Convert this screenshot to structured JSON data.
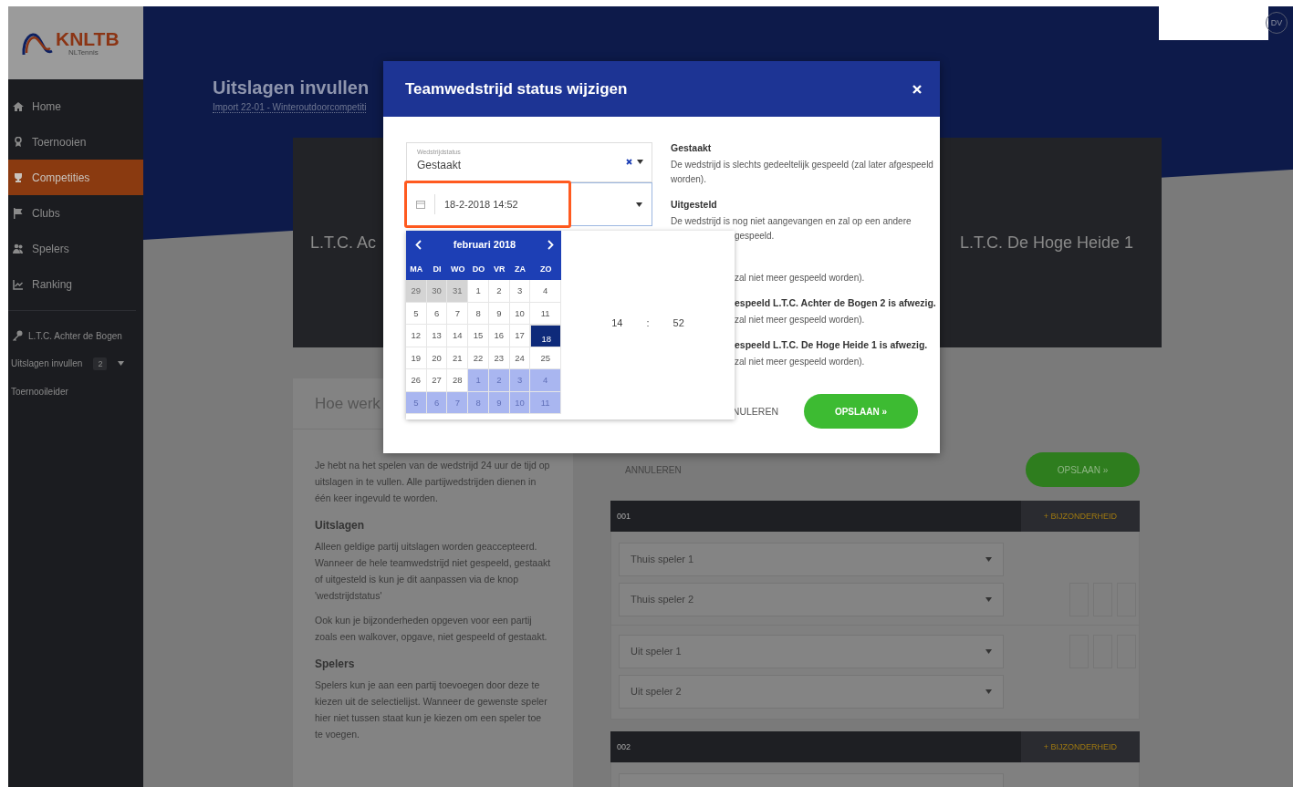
{
  "sidebar": {
    "logo": {
      "name": "KNLTB",
      "tagline": "NLTennis"
    },
    "items": [
      {
        "label": "Home",
        "selected": false
      },
      {
        "label": "Toernooien",
        "selected": false
      },
      {
        "label": "Competities",
        "selected": true
      },
      {
        "label": "Clubs",
        "selected": false
      },
      {
        "label": "Spelers",
        "selected": false
      },
      {
        "label": "Ranking",
        "selected": false
      }
    ],
    "club": "L.T.C. Achter de Bogen",
    "sub_items": [
      {
        "label": "Uitslagen invullen",
        "badge": "2"
      },
      {
        "label": "Toernooileider"
      }
    ]
  },
  "header": {
    "title": "Uitslagen invullen",
    "subtitle": "Import 22-01 - Winteroutdoorcompetiti",
    "avatar": "DV"
  },
  "match": {
    "home_team": "L.T.C. Ac",
    "away_team": "L.T.C. De Hoge Heide 1"
  },
  "help": {
    "title": "Hoe werk",
    "sections": [
      {
        "paragraphs": [
          "Je hebt na het spelen van de wedstrijd 24 uur de tijd op uitslagen in te vullen. Alle partijwedstrijden dienen in één keer ingevuld te worden."
        ]
      },
      {
        "heading": "Uitslagen",
        "paragraphs": [
          "Alleen geldige partij uitslagen worden geaccepteerd. Wanneer de hele teamwedstrijd niet gespeeld, gestaakt of uitgesteld is kun je dit aanpassen via de knop 'wedstrijdstatus'",
          "Ook kun je bijzonderheden opgeven voor een partij zoals een walkover, opgave, niet gespeeld of gestaakt."
        ]
      },
      {
        "heading": "Spelers",
        "paragraphs": [
          "Spelers kun je aan een partij toevoegen door deze te kiezen uit de selectielijst. Wanneer de gewenste speler hier niet tussen staat kun je kiezen om een speler toe te voegen."
        ]
      }
    ]
  },
  "form": {
    "cancel": "ANNULEREN",
    "save": "OPSLAAN »",
    "matches": [
      {
        "code": "001",
        "action": "+ BIJZONDERHEID",
        "players": [
          "Thuis speler 1",
          "Thuis speler 2",
          "Uit speler 1",
          "Uit speler 2"
        ]
      },
      {
        "code": "002",
        "action": "+ BIJZONDERHEID"
      }
    ]
  },
  "modal": {
    "title": "Teamwedstrijd status wijzigen",
    "status_field": {
      "label": "Wedstrijdstatus",
      "value": "Gestaakt"
    },
    "date_field": {
      "value": "18-2-2018 14:52"
    },
    "datepicker": {
      "month": "februari 2018",
      "weekdays": [
        "MA",
        "DI",
        "WO",
        "DO",
        "VR",
        "ZA",
        "ZO"
      ],
      "weeks": [
        [
          {
            "d": "29",
            "kind": "prev",
            "selected": false
          },
          {
            "d": "30",
            "kind": "prev",
            "selected": false
          },
          {
            "d": "31",
            "kind": "prev",
            "selected": false
          },
          {
            "d": "1",
            "kind": "day",
            "selected": false
          },
          {
            "d": "2",
            "kind": "day",
            "selected": false
          },
          {
            "d": "3",
            "kind": "day",
            "selected": false
          },
          {
            "d": "4",
            "kind": "day",
            "selected": false
          }
        ],
        [
          {
            "d": "5",
            "kind": "day",
            "selected": false
          },
          {
            "d": "6",
            "kind": "day",
            "selected": false
          },
          {
            "d": "7",
            "kind": "day",
            "selected": false
          },
          {
            "d": "8",
            "kind": "day",
            "selected": false
          },
          {
            "d": "9",
            "kind": "day",
            "selected": false
          },
          {
            "d": "10",
            "kind": "day",
            "selected": false
          },
          {
            "d": "11",
            "kind": "day",
            "selected": false
          }
        ],
        [
          {
            "d": "12",
            "kind": "day",
            "selected": false
          },
          {
            "d": "13",
            "kind": "day",
            "selected": false
          },
          {
            "d": "14",
            "kind": "day",
            "selected": false
          },
          {
            "d": "15",
            "kind": "day",
            "selected": false
          },
          {
            "d": "16",
            "kind": "day",
            "selected": false
          },
          {
            "d": "17",
            "kind": "day",
            "selected": false
          },
          {
            "d": "18",
            "kind": "day",
            "selected": true
          }
        ],
        [
          {
            "d": "19",
            "kind": "day",
            "selected": false
          },
          {
            "d": "20",
            "kind": "day",
            "selected": false
          },
          {
            "d": "21",
            "kind": "day",
            "selected": false
          },
          {
            "d": "22",
            "kind": "day",
            "selected": false
          },
          {
            "d": "23",
            "kind": "day",
            "selected": false
          },
          {
            "d": "24",
            "kind": "day",
            "selected": false
          },
          {
            "d": "25",
            "kind": "day",
            "selected": false
          }
        ],
        [
          {
            "d": "26",
            "kind": "day",
            "selected": false
          },
          {
            "d": "27",
            "kind": "day",
            "selected": false
          },
          {
            "d": "28",
            "kind": "day",
            "selected": false
          },
          {
            "d": "1",
            "kind": "next",
            "selected": false
          },
          {
            "d": "2",
            "kind": "next",
            "selected": false
          },
          {
            "d": "3",
            "kind": "next",
            "selected": false
          },
          {
            "d": "4",
            "kind": "next",
            "selected": false
          }
        ],
        [
          {
            "d": "5",
            "kind": "next",
            "selected": false
          },
          {
            "d": "6",
            "kind": "next",
            "selected": false
          },
          {
            "d": "7",
            "kind": "next",
            "selected": false
          },
          {
            "d": "8",
            "kind": "next",
            "selected": false
          },
          {
            "d": "9",
            "kind": "next",
            "selected": false
          },
          {
            "d": "10",
            "kind": "next",
            "selected": false
          },
          {
            "d": "11",
            "kind": "next",
            "selected": false
          }
        ]
      ],
      "hours": "14",
      "separator": ":",
      "minutes": "52"
    },
    "statuses": [
      {
        "rows": [
          {
            "kind": "title",
            "text": "Gestaakt",
            "clipped": false
          },
          {
            "kind": "text",
            "text": "De wedstrijd is slechts gedeeltelijk gespeeld (zal later afgespeeld worden).",
            "clipped": false
          }
        ]
      },
      {
        "rows": [
          {
            "kind": "title",
            "text": "Uitgesteld",
            "clipped": false
          },
          {
            "kind": "text",
            "text": "De wedstrijd is nog niet aangevangen en zal op een andere",
            "clipped": false
          },
          {
            "kind": "text",
            "text": "gespeeld.",
            "clipped": true
          }
        ]
      },
      {
        "rows": [
          {
            "kind": "text",
            "text": "zal niet meer gespeeld worden).",
            "clipped": true
          }
        ]
      },
      {
        "rows": [
          {
            "kind": "title",
            "text": "espeeld L.T.C. Achter de Bogen 2 is afwezig.",
            "clipped": true
          },
          {
            "kind": "text",
            "text": "zal niet meer gespeeld worden).",
            "clipped": true
          }
        ]
      },
      {
        "rows": [
          {
            "kind": "title",
            "text": "espeeld L.T.C. De Hoge Heide 1 is afwezig.",
            "clipped": true
          },
          {
            "kind": "text",
            "text": "zal niet meer gespeeld worden).",
            "clipped": true
          }
        ]
      }
    ],
    "cancel": "NULEREN",
    "save": "OPSLAAN »"
  }
}
